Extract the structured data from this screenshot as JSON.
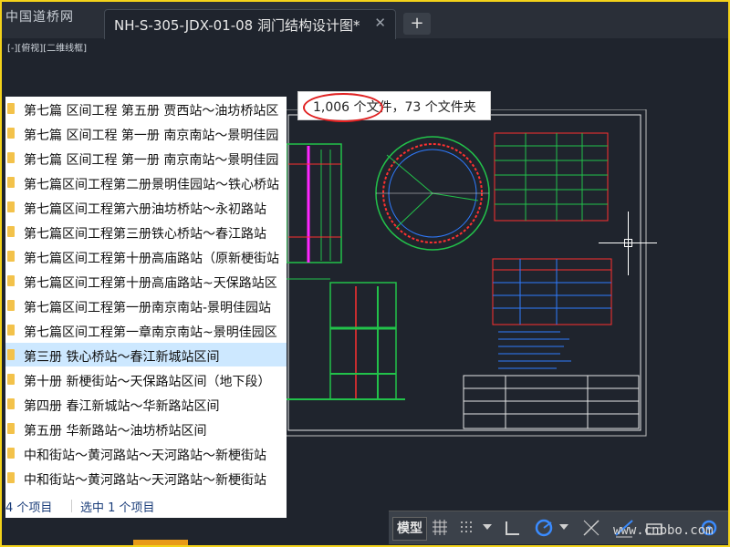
{
  "window": {
    "watermark_logo": "中国道桥网",
    "tab_title": "NH-S-305-JDX-01-08 洞门结构设计图*",
    "tab_close": "✕",
    "new_tab": "+",
    "viewport_label": "[-][俯视][二维线框]"
  },
  "tooltip": {
    "text": "1,006 个文件，73 个文件夹"
  },
  "file_list": {
    "items": [
      {
        "label": "第七篇 区间工程 第五册 贾西站～油坊桥站区"
      },
      {
        "label": "第七篇 区间工程 第一册 南京南站～景明佳园"
      },
      {
        "label": "第七篇 区间工程 第一册 南京南站～景明佳园"
      },
      {
        "label": "第七篇区间工程第二册景明佳园站～铁心桥站"
      },
      {
        "label": "第七篇区间工程第六册油坊桥站～永初路站"
      },
      {
        "label": "第七篇区间工程第三册铁心桥站～春江路站"
      },
      {
        "label": "第七篇区间工程第十册高庙路站（原新梗街站"
      },
      {
        "label": "第七篇区间工程第十册高庙路站~天保路站区"
      },
      {
        "label": "第七篇区间工程第一册南京南站-景明佳园站"
      },
      {
        "label": "第七篇区间工程第一章南京南站~景明佳园区"
      },
      {
        "label": "第三册 铁心桥站～春江新城站区间"
      },
      {
        "label": "第十册 新梗街站～天保路站区间（地下段）"
      },
      {
        "label": "第四册 春江新城站～华新路站区间"
      },
      {
        "label": "第五册 华新路站～油坊桥站区间"
      },
      {
        "label": "中和街站～黄河路站～天河路站～新梗街站"
      },
      {
        "label": "中和街站～黄河路站～天河路站～新梗街站"
      }
    ],
    "selected_index": 10,
    "status_count": "4 个项目",
    "status_selected": "选中 1 个项目"
  },
  "bottom_toolbar": {
    "model_label": "模型",
    "watermark": "www.cnbbo.com"
  },
  "colors": {
    "frame": "#f3d21a",
    "cad_background": "#1f242d",
    "highlight_circle": "#e02020",
    "selected_row": "#cde8ff"
  }
}
